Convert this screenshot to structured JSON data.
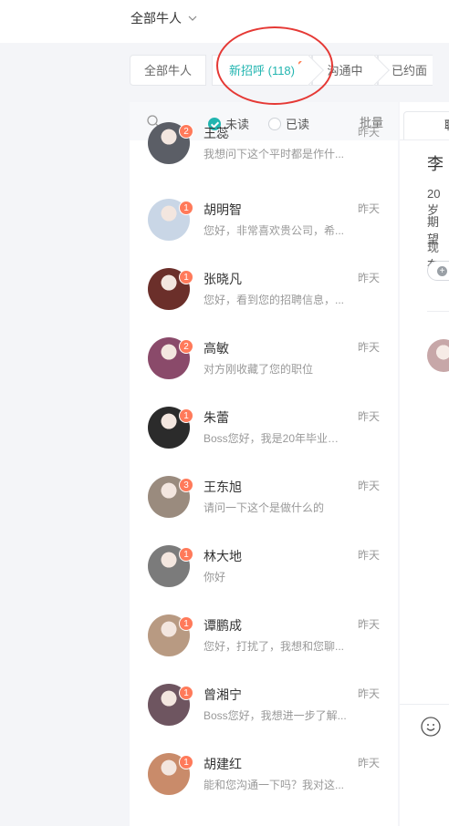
{
  "topbar": {
    "filter_label": "全部牛人"
  },
  "steps": [
    {
      "label": "全部牛人",
      "dot": false
    },
    {
      "label": "新招呼 (118)",
      "dot": true
    },
    {
      "label": "沟通中",
      "dot": true
    },
    {
      "label": "已约面",
      "dot": false
    }
  ],
  "list_header": {
    "unread_label": "未读",
    "read_label": "已读",
    "batch_label": "批量"
  },
  "conversations": [
    {
      "name": "王蕊",
      "time": "昨天",
      "message": "我想问下这个平时都是作什...",
      "badge": "2",
      "avatar_color": "#5b5e66"
    },
    {
      "name": "胡明智",
      "time": "昨天",
      "message": "您好，非常喜欢贵公司，希...",
      "badge": "1",
      "avatar_color": "#c9d6e6"
    },
    {
      "name": "张晓凡",
      "time": "昨天",
      "message": "您好，看到您的招聘信息，...",
      "badge": "1",
      "avatar_color": "#6b2f2a"
    },
    {
      "name": "高敏",
      "time": "昨天",
      "message": "对方刚收藏了您的职位",
      "badge": "2",
      "avatar_color": "#8a4a6a"
    },
    {
      "name": "朱蕾",
      "time": "昨天",
      "message": "Boss您好，我是20年毕业生...",
      "badge": "1",
      "avatar_color": "#2b2b2b"
    },
    {
      "name": "王东旭",
      "time": "昨天",
      "message": "请问一下这个是做什么的",
      "badge": "3",
      "avatar_color": "#9a8b7e"
    },
    {
      "name": "林大地",
      "time": "昨天",
      "message": "你好",
      "badge": "1",
      "avatar_color": "#7b7b7b"
    },
    {
      "name": "谭鹏成",
      "time": "昨天",
      "message": "您好，打扰了，我想和您聊...",
      "badge": "1",
      "avatar_color": "#b89a82"
    },
    {
      "name": "曾湘宁",
      "time": "昨天",
      "message": "Boss您好，我想进一步了解...",
      "badge": "1",
      "avatar_color": "#6e5560"
    },
    {
      "name": "胡建红",
      "time": "昨天",
      "message": "能和您沟通一下吗？我对这...",
      "badge": "1",
      "avatar_color": "#c98b6a"
    }
  ],
  "detail": {
    "tab_label": "聊",
    "name": "李",
    "line1": "20岁",
    "line2": "期望",
    "line3": "现在",
    "avatar_color": "#c7a7a8"
  },
  "colors": {
    "accent": "#22b5b0",
    "badge": "#ff7a5a",
    "annotation": "#e53935"
  }
}
